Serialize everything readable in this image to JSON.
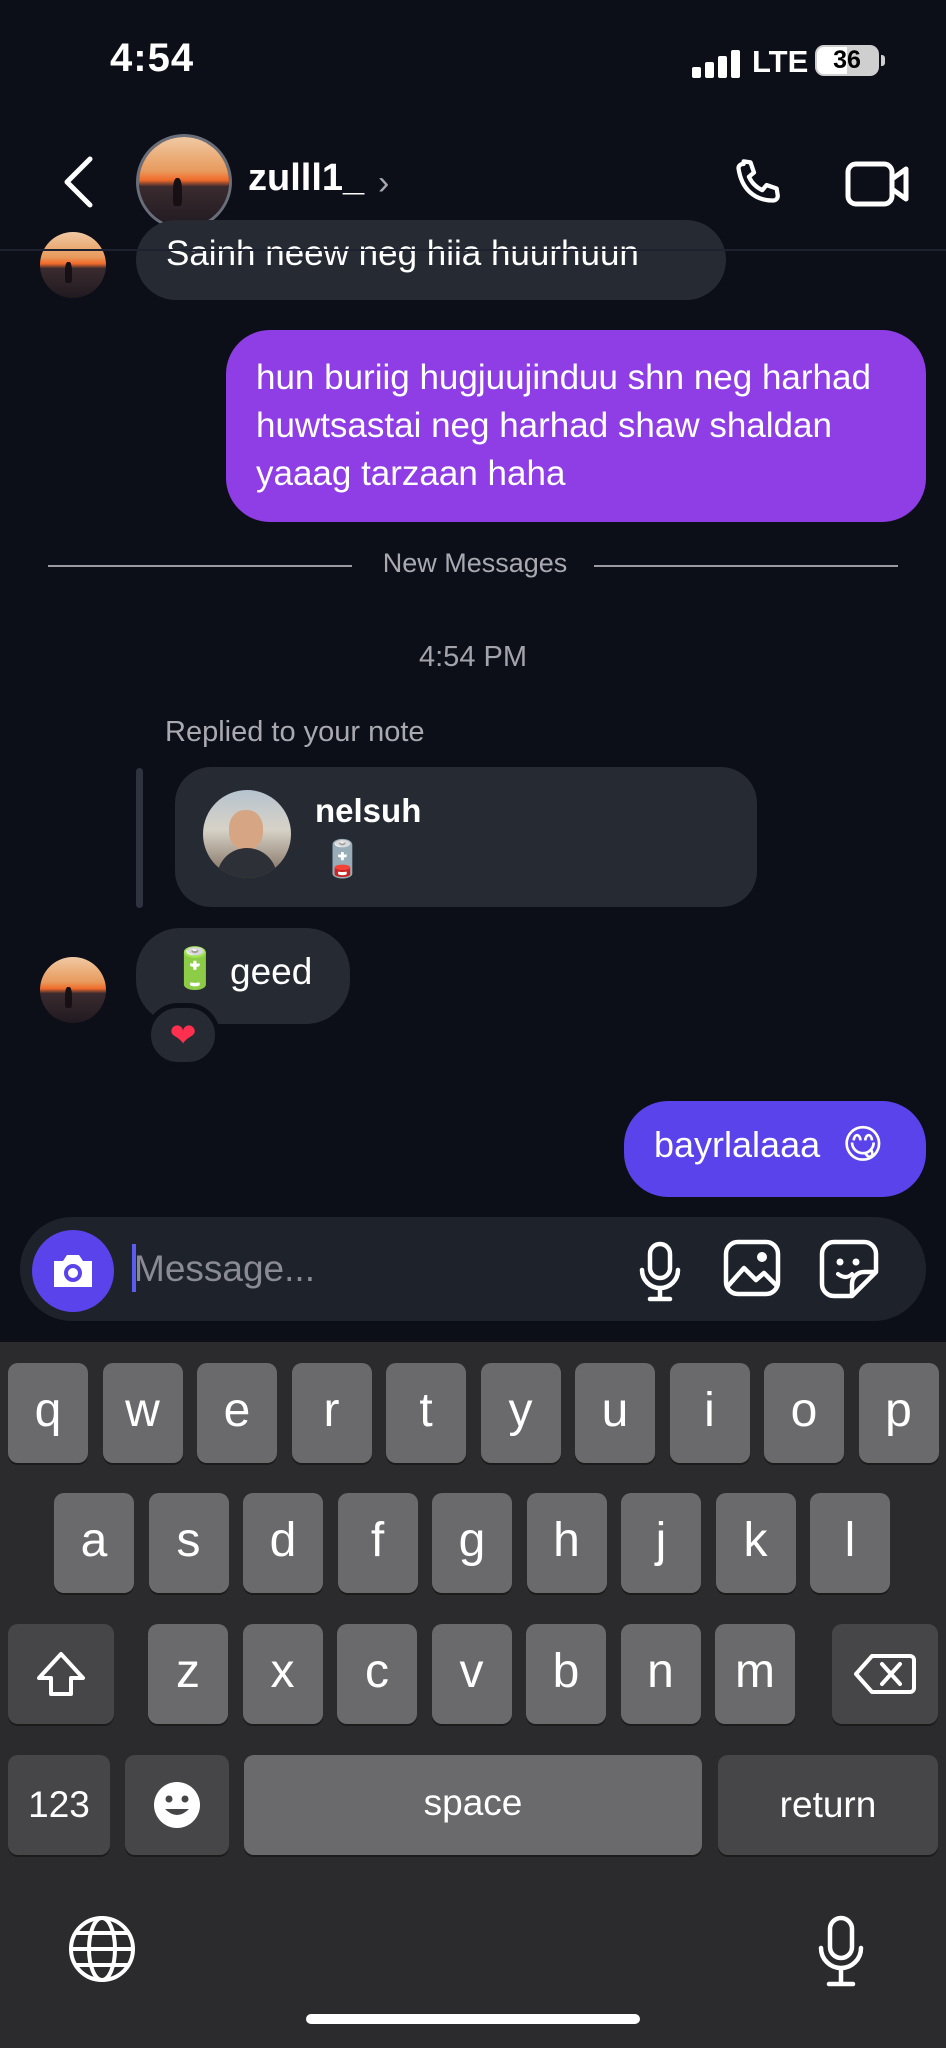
{
  "status_bar": {
    "time": "4:54",
    "network": "LTE",
    "battery": "36"
  },
  "header": {
    "username": "zulll1_",
    "chevron": "›"
  },
  "messages": {
    "partial_text": "Sainh neew neg hiia huurhuun",
    "outgoing_long": "hun buriig hugjuujinduu shn neg harhad huwtsastai neg harhad shaw shaldan yaaag tarzaan haha",
    "new_messages_label": "New Messages",
    "timestamp": "4:54 PM",
    "replied_label": "Replied to your note",
    "note": {
      "name": "nelsuh",
      "emoji": "🪫"
    },
    "incoming": {
      "emoji": "🔋",
      "text": "geed",
      "reaction": "❤"
    },
    "outgoing_last": {
      "text": "bayrlalaaa",
      "emoji": "😋"
    }
  },
  "composer": {
    "placeholder": "Message..."
  },
  "keyboard": {
    "row1": [
      "q",
      "w",
      "e",
      "r",
      "t",
      "y",
      "u",
      "i",
      "o",
      "p"
    ],
    "row2": [
      "a",
      "s",
      "d",
      "f",
      "g",
      "h",
      "j",
      "k",
      "l"
    ],
    "row3": [
      "z",
      "x",
      "c",
      "v",
      "b",
      "n",
      "m"
    ],
    "numbers_label": "123",
    "space_label": "space",
    "return_label": "return"
  },
  "colors": {
    "outgoing_purple": "#8f3ee6",
    "outgoing_blue": "#5a43ea",
    "incoming_bubble": "#262a33",
    "background": "#0c0f17"
  }
}
